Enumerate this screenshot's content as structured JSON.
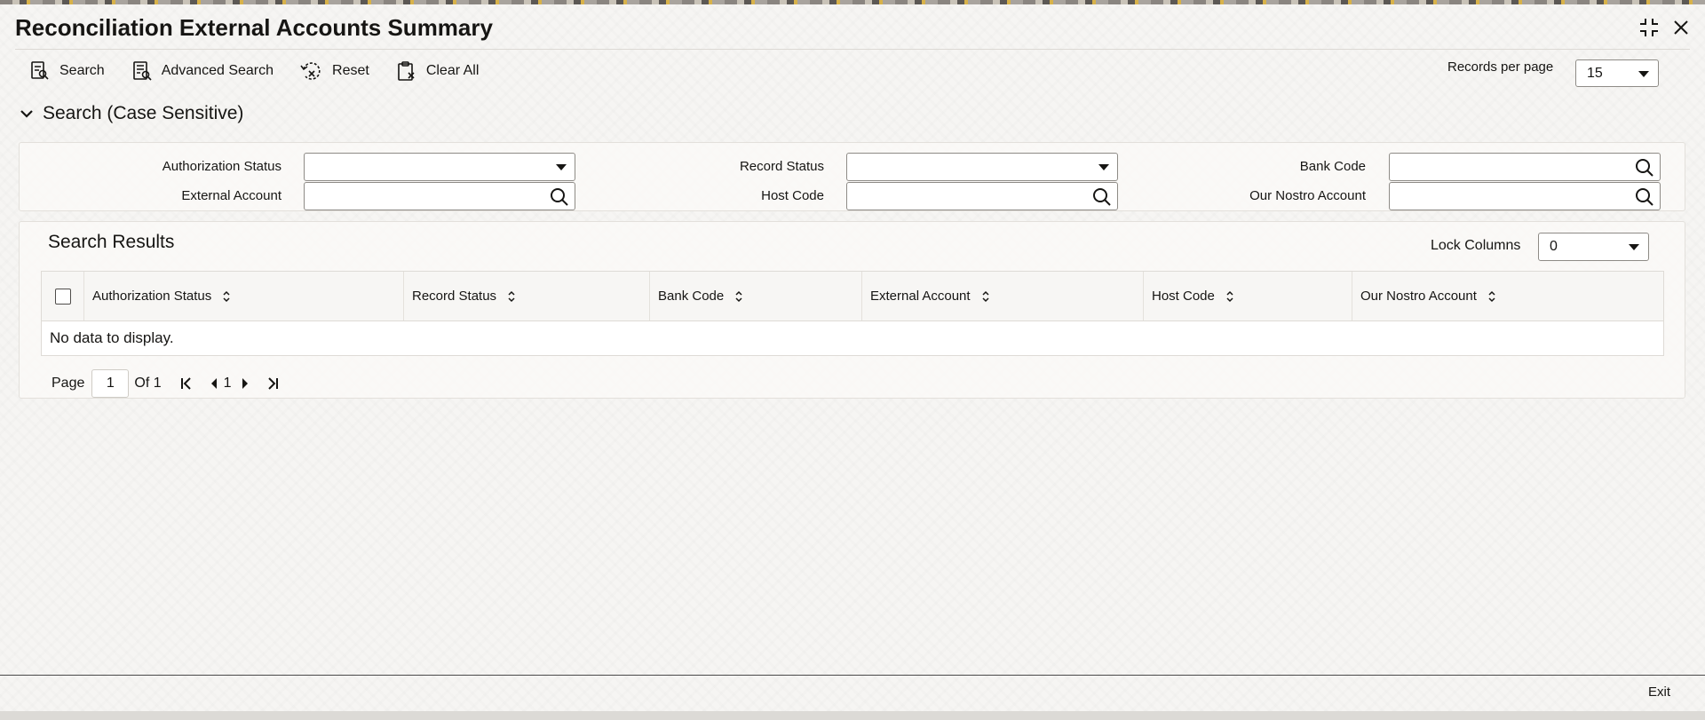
{
  "window": {
    "title": "Reconciliation External Accounts Summary"
  },
  "toolbar": {
    "search": "Search",
    "advanced_search": "Advanced Search",
    "reset": "Reset",
    "clear_all": "Clear All"
  },
  "records_per_page": {
    "label": "Records per page",
    "value": "15"
  },
  "search_section": {
    "title": "Search (Case Sensitive)",
    "fields": [
      {
        "label": "Authorization Status",
        "type": "select",
        "value": ""
      },
      {
        "label": "Record Status",
        "type": "select",
        "value": ""
      },
      {
        "label": "Bank Code",
        "type": "lookup",
        "value": ""
      },
      {
        "label": "External Account",
        "type": "lookup",
        "value": ""
      },
      {
        "label": "Host Code",
        "type": "lookup",
        "value": ""
      },
      {
        "label": "Our Nostro Account",
        "type": "lookup",
        "value": ""
      }
    ]
  },
  "results": {
    "title": "Search Results",
    "lock_columns_label": "Lock Columns",
    "lock_columns_value": "0",
    "columns": [
      "Authorization Status",
      "Record Status",
      "Bank Code",
      "External Account",
      "Host Code",
      "Our Nostro Account"
    ],
    "empty_message": "No data to display."
  },
  "pagination": {
    "page_label": "Page",
    "current_page": "1",
    "of_label": "Of 1",
    "page_link": "1"
  },
  "footer": {
    "exit": "Exit"
  },
  "icons": {
    "maximize": "compress-icon",
    "close": "close-icon",
    "search": "search-doc-icon",
    "advanced_search": "advanced-search-icon",
    "reset": "reset-icon",
    "clear_all": "clipboard-clear-icon",
    "lookup": "magnifier-icon",
    "collapse": "chevron-down-icon",
    "sort": "sort-icon"
  }
}
